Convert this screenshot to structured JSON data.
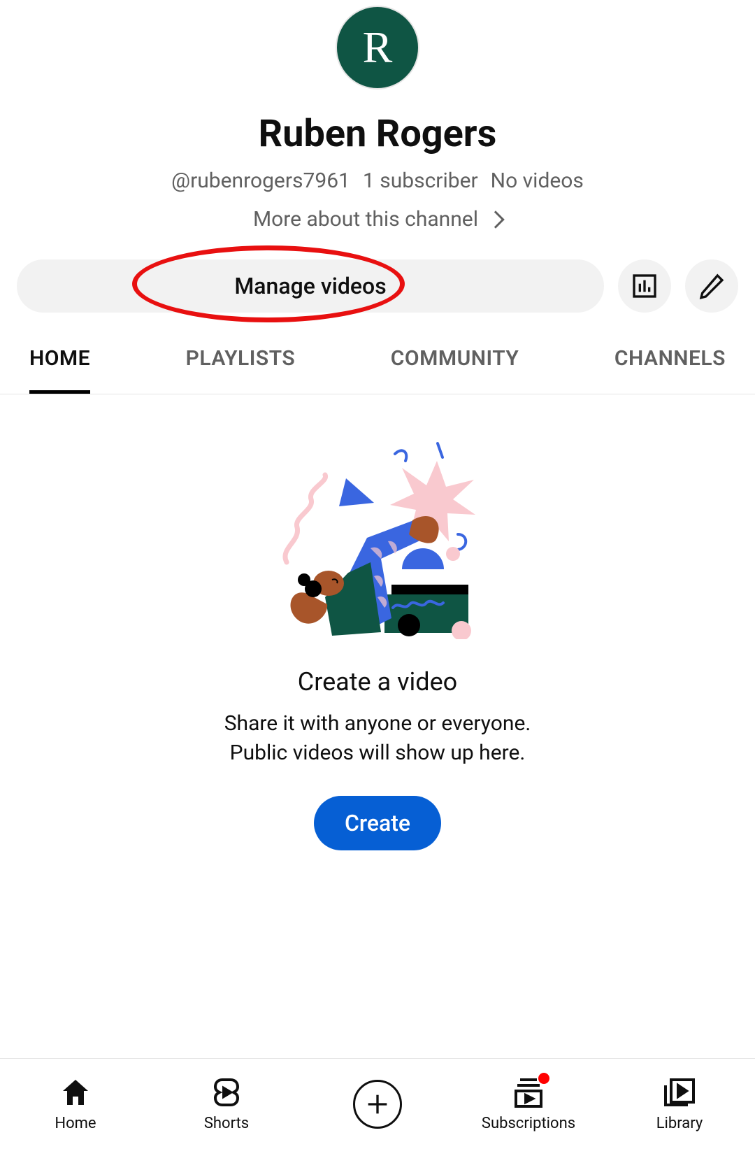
{
  "profile": {
    "avatar_letter": "R",
    "channel_name": "Ruben Rogers",
    "handle": "@rubenrogers7961",
    "subscribers": "1 subscriber",
    "video_count": "No videos",
    "more_about": "More about this channel"
  },
  "actions": {
    "manage_videos": "Manage videos"
  },
  "tabs": {
    "home": "HOME",
    "playlists": "PLAYLISTS",
    "community": "COMMUNITY",
    "channels": "CHANNELS"
  },
  "empty_state": {
    "title": "Create a video",
    "line1": "Share it with anyone or everyone.",
    "line2": "Public videos will show up here.",
    "button": "Create"
  },
  "bottom_nav": {
    "home": "Home",
    "shorts": "Shorts",
    "subscriptions": "Subscriptions",
    "library": "Library"
  },
  "annotation": {
    "highlight": "manage-videos-button",
    "color": "#e81010"
  }
}
